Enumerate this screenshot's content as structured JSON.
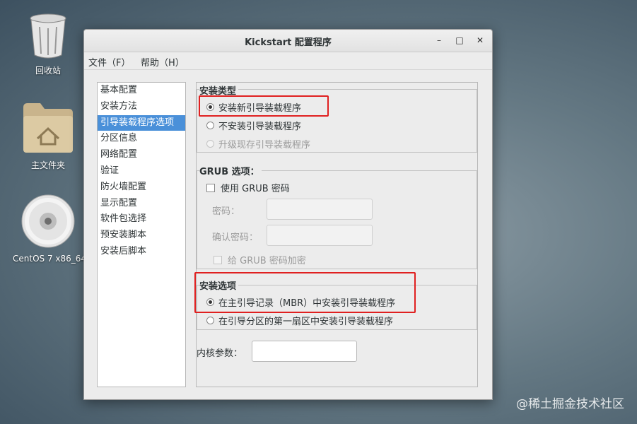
{
  "desktop": {
    "icons": [
      {
        "label": "回收站",
        "icon": "trash-icon"
      },
      {
        "label": "主文件夹",
        "icon": "home-folder-icon"
      },
      {
        "label": "CentOS 7 x86_64",
        "icon": "disc-icon"
      }
    ]
  },
  "window": {
    "title": "Kickstart 配置程序",
    "controls": {
      "minimize": "–",
      "maximize": "□",
      "close": "✕"
    }
  },
  "menubar": {
    "file": "文件（F）",
    "help": "帮助（H）"
  },
  "sidebar": {
    "items": [
      {
        "label": "基本配置"
      },
      {
        "label": "安装方法"
      },
      {
        "label": "引导装载程序选项",
        "selected": true
      },
      {
        "label": "分区信息"
      },
      {
        "label": "网络配置"
      },
      {
        "label": "验证"
      },
      {
        "label": "防火墙配置"
      },
      {
        "label": "显示配置"
      },
      {
        "label": "软件包选择"
      },
      {
        "label": "预安装脚本"
      },
      {
        "label": "安装后脚本"
      }
    ]
  },
  "install_type": {
    "title": "安装类型",
    "options": [
      {
        "label": "安装新引导装载程序",
        "checked": true,
        "disabled": false
      },
      {
        "label": "不安装引导装载程序",
        "checked": false,
        "disabled": false
      },
      {
        "label": "升级现存引导装载程序",
        "checked": false,
        "disabled": true
      }
    ]
  },
  "grub": {
    "title": "GRUB 选项：",
    "use_password": "使用  GRUB 密码",
    "password_label": "密码：",
    "password_value": "",
    "confirm_label": "确认密码：",
    "confirm_value": "",
    "encrypt": "给  GRUB 密码加密"
  },
  "install_options": {
    "title": "安装选项",
    "options": [
      {
        "label": "在主引导记录（MBR）中安装引导装载程序",
        "checked": true
      },
      {
        "label": "在引导分区的第一扇区中安装引导装载程序",
        "checked": false
      }
    ]
  },
  "kernel": {
    "label": "内核参数：",
    "value": ""
  },
  "watermark": "@稀土掘金技术社区",
  "colors": {
    "highlight": "#e02020",
    "selection": "#4a90d9"
  }
}
